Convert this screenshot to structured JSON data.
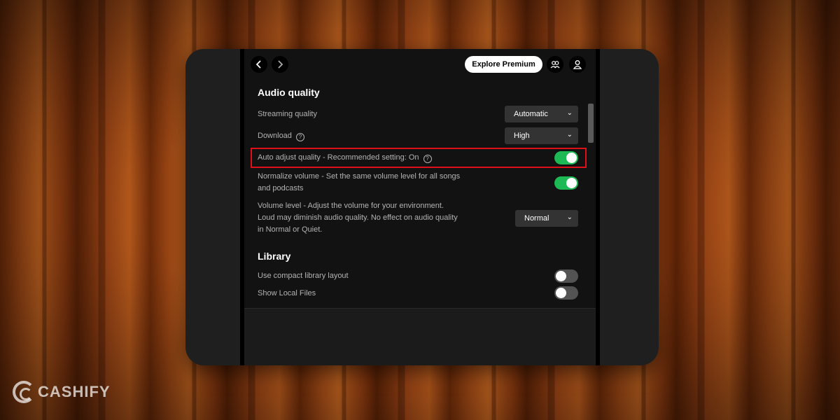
{
  "nav": {
    "back_icon": "chevron-left-icon",
    "forward_icon": "chevron-right-icon",
    "explore_premium_label": "Explore Premium",
    "friends_icon": "friends-icon",
    "user_icon": "user-icon"
  },
  "audio_quality": {
    "title": "Audio quality",
    "streaming_quality": {
      "label": "Streaming quality",
      "value": "Automatic"
    },
    "download": {
      "label": "Download",
      "value": "High"
    },
    "auto_adjust": {
      "label": "Auto adjust quality - Recommended setting: On",
      "enabled": true
    },
    "normalize": {
      "label_line1": "Normalize volume - Set the same volume level for all songs",
      "label_line2": "and podcasts",
      "enabled": true
    },
    "volume_level": {
      "label_line1": "Volume level - Adjust the volume for your environment.",
      "label_line2": "Loud may diminish audio quality. No effect on audio quality",
      "label_line3": "in Normal or Quiet.",
      "value": "Normal"
    }
  },
  "library": {
    "title": "Library",
    "compact_layout": {
      "label": "Use compact library layout",
      "enabled": false
    },
    "local_files": {
      "label": "Show Local Files",
      "enabled": false
    }
  },
  "watermark": {
    "brand": "CASHIFY"
  },
  "colors": {
    "accent": "#1db954",
    "highlight": "#e0101a",
    "background": "#121212"
  }
}
